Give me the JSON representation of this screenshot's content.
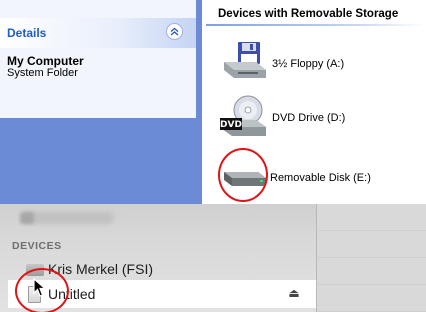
{
  "details_panel": {
    "title": "Details",
    "collapse_glyph": "»",
    "item_name": "My Computer",
    "item_type": "System Folder"
  },
  "removable_group": {
    "header": "Devices with Removable Storage",
    "drives": [
      {
        "label": "3½ Floppy (A:)",
        "icon": "floppy-drive-icon"
      },
      {
        "label": "DVD Drive (D:)",
        "icon": "dvd-drive-icon",
        "badge": "DVD"
      },
      {
        "label": "Removable Disk (E:)",
        "icon": "removable-disk-icon"
      }
    ]
  },
  "mac_sidebar": {
    "section_header": "DEVICES",
    "devices": [
      {
        "label": "Kris Merkel (FSI)",
        "icon": "hard-drive-icon"
      },
      {
        "label": "Untitled",
        "icon": "usb-drive-icon",
        "eject_glyph": "⏏"
      }
    ]
  },
  "annotation_color": "#e01414"
}
